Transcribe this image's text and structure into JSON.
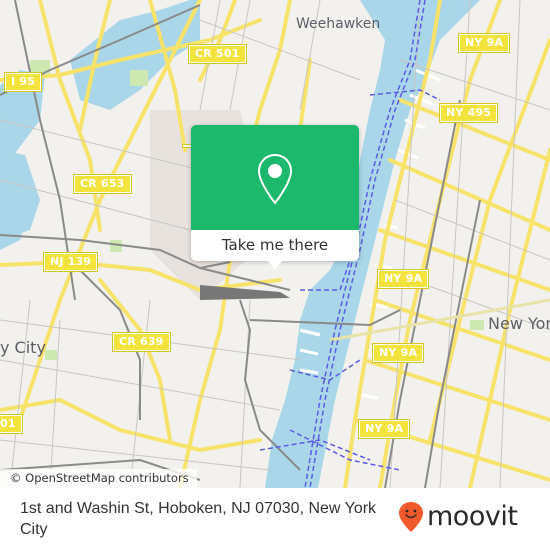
{
  "map": {
    "colors": {
      "land": "#f2f1ee",
      "water": "#a9d6e9",
      "road_major": "#f7e36a",
      "road_minor": "#ffffff",
      "rail": "#8a8a8a",
      "ferry": "#5b5be6",
      "park": "#cde8b0",
      "urban": "#e7e2de"
    },
    "place_labels": [
      {
        "id": "weehawken",
        "text": "Weehawken"
      },
      {
        "id": "new-york",
        "text": "New Yor"
      },
      {
        "id": "jersey-city",
        "text": "y City"
      }
    ],
    "route_shields": [
      {
        "id": "i95",
        "text": "I 95"
      },
      {
        "id": "cr501",
        "text": "CR 501"
      },
      {
        "id": "cr653",
        "text": "CR 653"
      },
      {
        "id": "nj139",
        "text": "NJ 139"
      },
      {
        "id": "cr639",
        "text": "CR 639"
      },
      {
        "id": "ny9a-top",
        "text": "NY 9A"
      },
      {
        "id": "ny495",
        "text": "NY 495"
      },
      {
        "id": "ny9a-mid1",
        "text": "NY 9A"
      },
      {
        "id": "ny9a-mid2",
        "text": "NY 9A"
      },
      {
        "id": "ny9a-bottom",
        "text": "NY 9A"
      },
      {
        "id": "cr501-left",
        "text": "01"
      },
      {
        "id": "partial-left",
        "text": ""
      }
    ],
    "attribution": "© OpenStreetMap contributors"
  },
  "popup": {
    "icon": "map-pin-icon",
    "button_label": "Take me there",
    "color": "#1cb86c"
  },
  "footer": {
    "address": "1st and Washin St, Hoboken, NJ 07030, New York City",
    "logo": {
      "icon": "moovit-pin-smile-icon",
      "text": "moovit",
      "color": "#f0592a"
    }
  }
}
